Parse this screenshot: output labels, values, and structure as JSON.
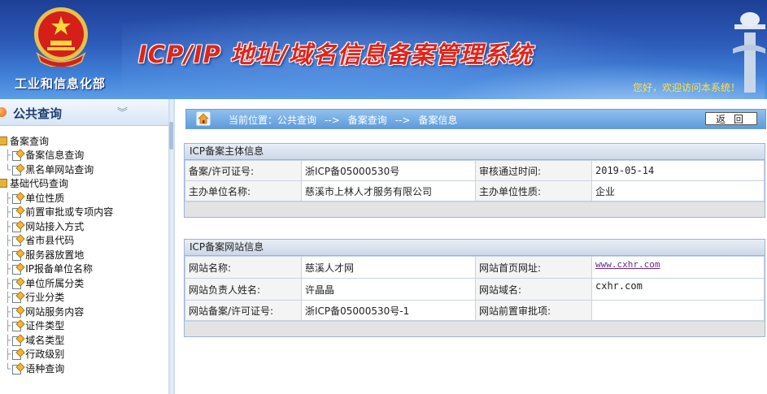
{
  "header": {
    "ministry": "工业和信息化部",
    "system_title": "ICP/IP 地址/域名信息备案管理系统",
    "welcome": "您好，欢迎访问本系统！"
  },
  "sidebar": {
    "title": "公共查询",
    "groups": [
      {
        "label": "备案查询",
        "items": [
          "备案信息查询",
          "黑名单网站查询"
        ]
      },
      {
        "label": "基础代码查询",
        "items": [
          "单位性质",
          "前置审批或专项内容",
          "网站接入方式",
          "省市县代码",
          "服务器放置地",
          "IP报备单位名称",
          "单位所属分类",
          "行业分类",
          "网站服务内容",
          "证件类型",
          "域名类型",
          "行政级别",
          "语种查询"
        ]
      }
    ]
  },
  "breadcrumb": {
    "prefix": "当前位置：",
    "items": [
      "公共查询",
      "备案查询",
      "备案信息"
    ],
    "sep": "-->",
    "back_label": "返回"
  },
  "subject_panel": {
    "title": "ICP备案主体信息",
    "rows": [
      {
        "l1": "备案/许可证号:",
        "v1": "浙ICP备05000530号",
        "l2": "审核通过时间:",
        "v2": "2019-05-14"
      },
      {
        "l1": "主办单位名称:",
        "v1": "慈溪市上林人才服务有限公司",
        "l2": "主办单位性质:",
        "v2": "企业"
      }
    ]
  },
  "site_panel": {
    "title": "ICP备案网站信息",
    "rows": [
      {
        "l1": "网站名称:",
        "v1": "慈溪人才网",
        "l2": "网站首页网址:",
        "v2": "www.cxhr.com"
      },
      {
        "l1": "网站负责人姓名:",
        "v1": "许晶晶",
        "l2": "网站域名:",
        "v2": "cxhr.com"
      },
      {
        "l1": "网站备案/许可证号:",
        "v1": "浙ICP备05000530号-1",
        "l2": "网站前置审批项:",
        "v2": ""
      }
    ]
  }
}
